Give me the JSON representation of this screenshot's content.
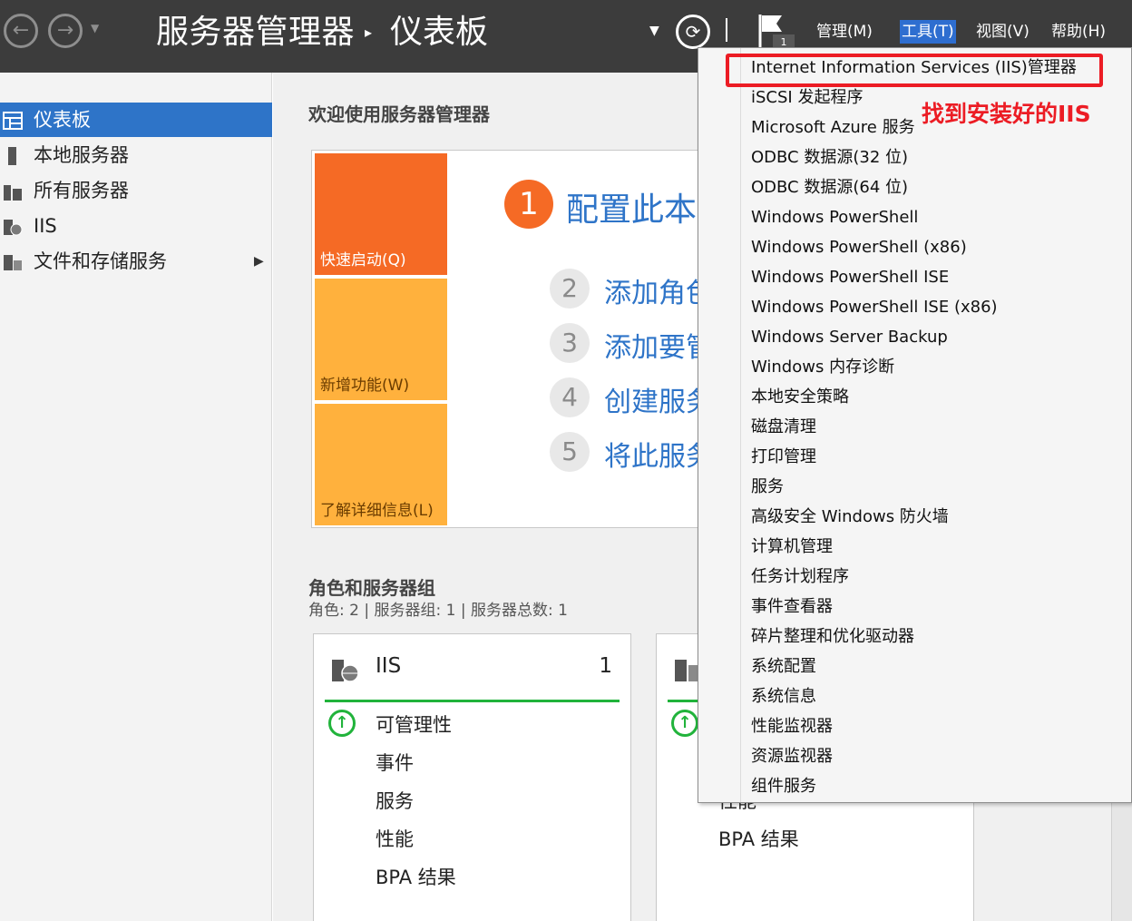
{
  "titlebar": {
    "app_title": "服务器管理器",
    "separator": "▸",
    "page_title": "仪表板",
    "flag_count": "1",
    "menu": {
      "manage": "管理(M)",
      "tools": "工具(T)",
      "view": "视图(V)",
      "help": "帮助(H)"
    }
  },
  "sidebar": {
    "items": [
      {
        "label": "仪表板",
        "icon": "dashboard-icon",
        "active": true
      },
      {
        "label": "本地服务器",
        "icon": "server-icon"
      },
      {
        "label": "所有服务器",
        "icon": "servers-icon"
      },
      {
        "label": "IIS",
        "icon": "iis-icon"
      },
      {
        "label": "文件和存储服务",
        "icon": "storage-icon",
        "has_arrow": true
      }
    ]
  },
  "welcome": {
    "title": "欢迎使用服务器管理器",
    "tiles": {
      "quick_start": "快速启动(Q)",
      "whats_new": "新增功能(W)",
      "learn_more": "了解详细信息(L)"
    },
    "steps": [
      {
        "number": "1",
        "label": "配置此本"
      },
      {
        "number": "2",
        "label": "添加角色"
      },
      {
        "number": "3",
        "label": "添加要管"
      },
      {
        "number": "4",
        "label": "创建服务"
      },
      {
        "number": "5",
        "label": "将此服务"
      }
    ]
  },
  "roles": {
    "title": "角色和服务器组",
    "subtitle": "角色: 2 | 服务器组: 1 | 服务器总数: 1",
    "cards": [
      {
        "title": "IIS",
        "count": "1",
        "rows": [
          "可管理性",
          "事件",
          "服务",
          "性能",
          "BPA 结果"
        ]
      },
      {
        "rows": [
          "性能",
          "BPA 结果"
        ]
      }
    ]
  },
  "tools_menu": {
    "items": [
      "Internet Information Services (IIS)管理器",
      "iSCSI 发起程序",
      "Microsoft Azure 服务",
      "ODBC 数据源(32 位)",
      "ODBC 数据源(64 位)",
      "Windows PowerShell",
      "Windows PowerShell (x86)",
      "Windows PowerShell ISE",
      "Windows PowerShell ISE (x86)",
      "Windows Server Backup",
      "Windows 内存诊断",
      "本地安全策略",
      "磁盘清理",
      "打印管理",
      "服务",
      "高级安全 Windows 防火墙",
      "计算机管理",
      "任务计划程序",
      "事件查看器",
      "碎片整理和优化驱动器",
      "系统配置",
      "系统信息",
      "性能监视器",
      "资源监视器",
      "组件服务"
    ],
    "annotation": "找到安装好的IIS",
    "highlight_color": "#ec1c24"
  },
  "colors": {
    "titlebar": "#3c3c3c",
    "accent": "#2e74c8",
    "orange": "#f56a25",
    "amber": "#ffb13d",
    "status_green": "#21b33b"
  }
}
